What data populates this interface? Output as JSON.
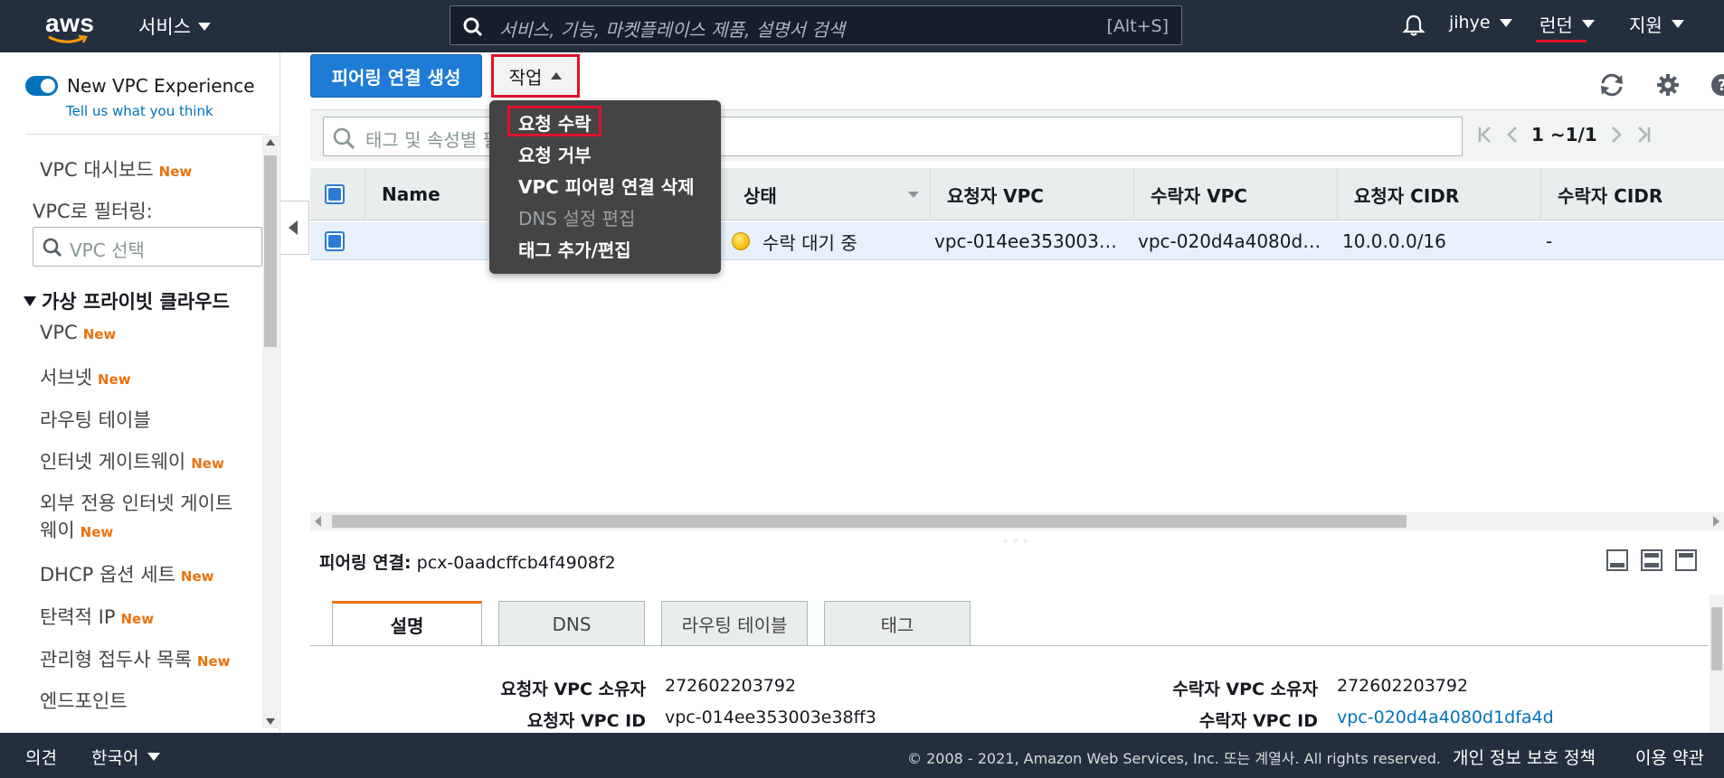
{
  "topnav": {
    "logo": "aws",
    "services_label": "서비스",
    "search_placeholder": "서비스, 기능, 마켓플레이스 제품, 설명서 검색",
    "search_shortcut": "[Alt+S]",
    "user_label": "jihye",
    "region_label": "런던",
    "support_label": "지원",
    "bell_icon": "bell-icon"
  },
  "sidebar": {
    "toggle_label": "New VPC Experience",
    "feedback_link": "Tell us what you think",
    "dashboard": {
      "label": "VPC 대시보드",
      "badge": "New"
    },
    "filter_label": "VPC로 필터링:",
    "vpc_select_placeholder": "VPC 선택",
    "section_title": "가상 프라이빗 클라우드",
    "items": [
      {
        "label": "VPC",
        "badge": "New"
      },
      {
        "label": "서브넷",
        "badge": "New"
      },
      {
        "label": "라우팅 테이블",
        "badge": ""
      },
      {
        "label": "인터넷 게이트웨이",
        "badge": "New"
      },
      {
        "label": "외부 전용 인터넷 게이트",
        "label2": "웨이",
        "badge": "New"
      },
      {
        "label": "DHCP 옵션 세트",
        "badge": "New"
      },
      {
        "label": "탄력적 IP",
        "badge": "New"
      },
      {
        "label": "관리형 접두사 목록",
        "badge": "New"
      },
      {
        "label": "엔드포인트",
        "badge": ""
      }
    ]
  },
  "toolbar": {
    "create_button": "피어링 연결 생성",
    "actions_button": "작업"
  },
  "actions_menu": {
    "items": [
      {
        "label": "요청 수락",
        "enabled": true
      },
      {
        "label": "요청 거부",
        "enabled": true
      },
      {
        "label": "VPC 피어링 연결 삭제",
        "enabled": true
      },
      {
        "label": "DNS 설정 편집",
        "enabled": false
      },
      {
        "label": "태그 추가/편집",
        "enabled": true
      }
    ]
  },
  "filter": {
    "placeholder": "태그 및 속성별 필터링 또는 키워드별 검색",
    "pager_text": "1 ~1/1"
  },
  "table": {
    "columns": [
      "Name",
      "상태",
      "요청자 VPC",
      "수락자 VPC",
      "요청자 CIDR",
      "수락자 CIDR"
    ],
    "rows": [
      {
        "name": "",
        "status": "수락 대기 중",
        "requester_vpc": "vpc-014ee353003…",
        "accepter_vpc": "vpc-020d4a4080d…",
        "requester_cidr": "10.0.0.0/16",
        "accepter_cidr": "-"
      }
    ]
  },
  "details": {
    "title_label": "피어링 연결:",
    "title_value": "pcx-0aadcffcb4f4908f2",
    "tabs": [
      "설명",
      "DNS",
      "라우팅 테이블",
      "태그"
    ],
    "fields": {
      "requester_owner_label": "요청자 VPC 소유자",
      "requester_owner_value": "272602203792",
      "accepter_owner_label": "수락자 VPC 소유자",
      "accepter_owner_value": "272602203792",
      "requester_vpc_id_label": "요청자 VPC ID",
      "requester_vpc_id_value": "vpc-014ee353003e38ff3",
      "accepter_vpc_id_label": "수락자 VPC ID",
      "accepter_vpc_id_value": "vpc-020d4a4080d1dfa4d"
    }
  },
  "footer": {
    "feedback": "의견",
    "language": "한국어",
    "copyright": "© 2008 - 2021, Amazon Web Services, Inc. 또는 계열사. All rights reserved.",
    "privacy": "개인 정보 보호 정책",
    "terms": "이용 약관"
  },
  "colors": {
    "nav_bg": "#232f3e",
    "primary_button": "#1f7cd6",
    "highlight_red": "#e0122c",
    "new_badge": "#ec7211",
    "link": "#0073bb"
  }
}
